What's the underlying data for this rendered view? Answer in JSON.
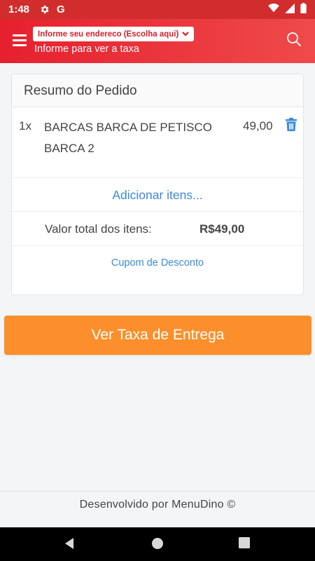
{
  "status_bar": {
    "time": "1:48",
    "icons": [
      "settings-gear-icon",
      "google-g-icon",
      "wifi-icon",
      "signal-icon",
      "battery-icon"
    ],
    "google_letter": "G"
  },
  "header": {
    "address_pill_label": "Informe seu endereco (Escolha aqui)",
    "address_subtitle": "Informe para ver a taxa",
    "brand_color": "#e6202e"
  },
  "order_summary": {
    "title": "Resumo do Pedido",
    "items": [
      {
        "qty": "1x",
        "name": "BARCAS BARCA DE PETISCO BARCA 2",
        "price": "49,00"
      }
    ],
    "add_items_label": "Adicionar itens...",
    "total_label": "Valor total dos itens:",
    "total_value": "R$49,00",
    "coupon_label": "Cupom de Desconto"
  },
  "cta": {
    "label": "Ver Taxa de Entrega",
    "color": "#fb8f2b"
  },
  "footer": {
    "text": "Desenvolvido por MenuDino ©"
  },
  "nav_bar": {
    "buttons": [
      "back-icon",
      "home-icon",
      "recents-icon"
    ]
  }
}
